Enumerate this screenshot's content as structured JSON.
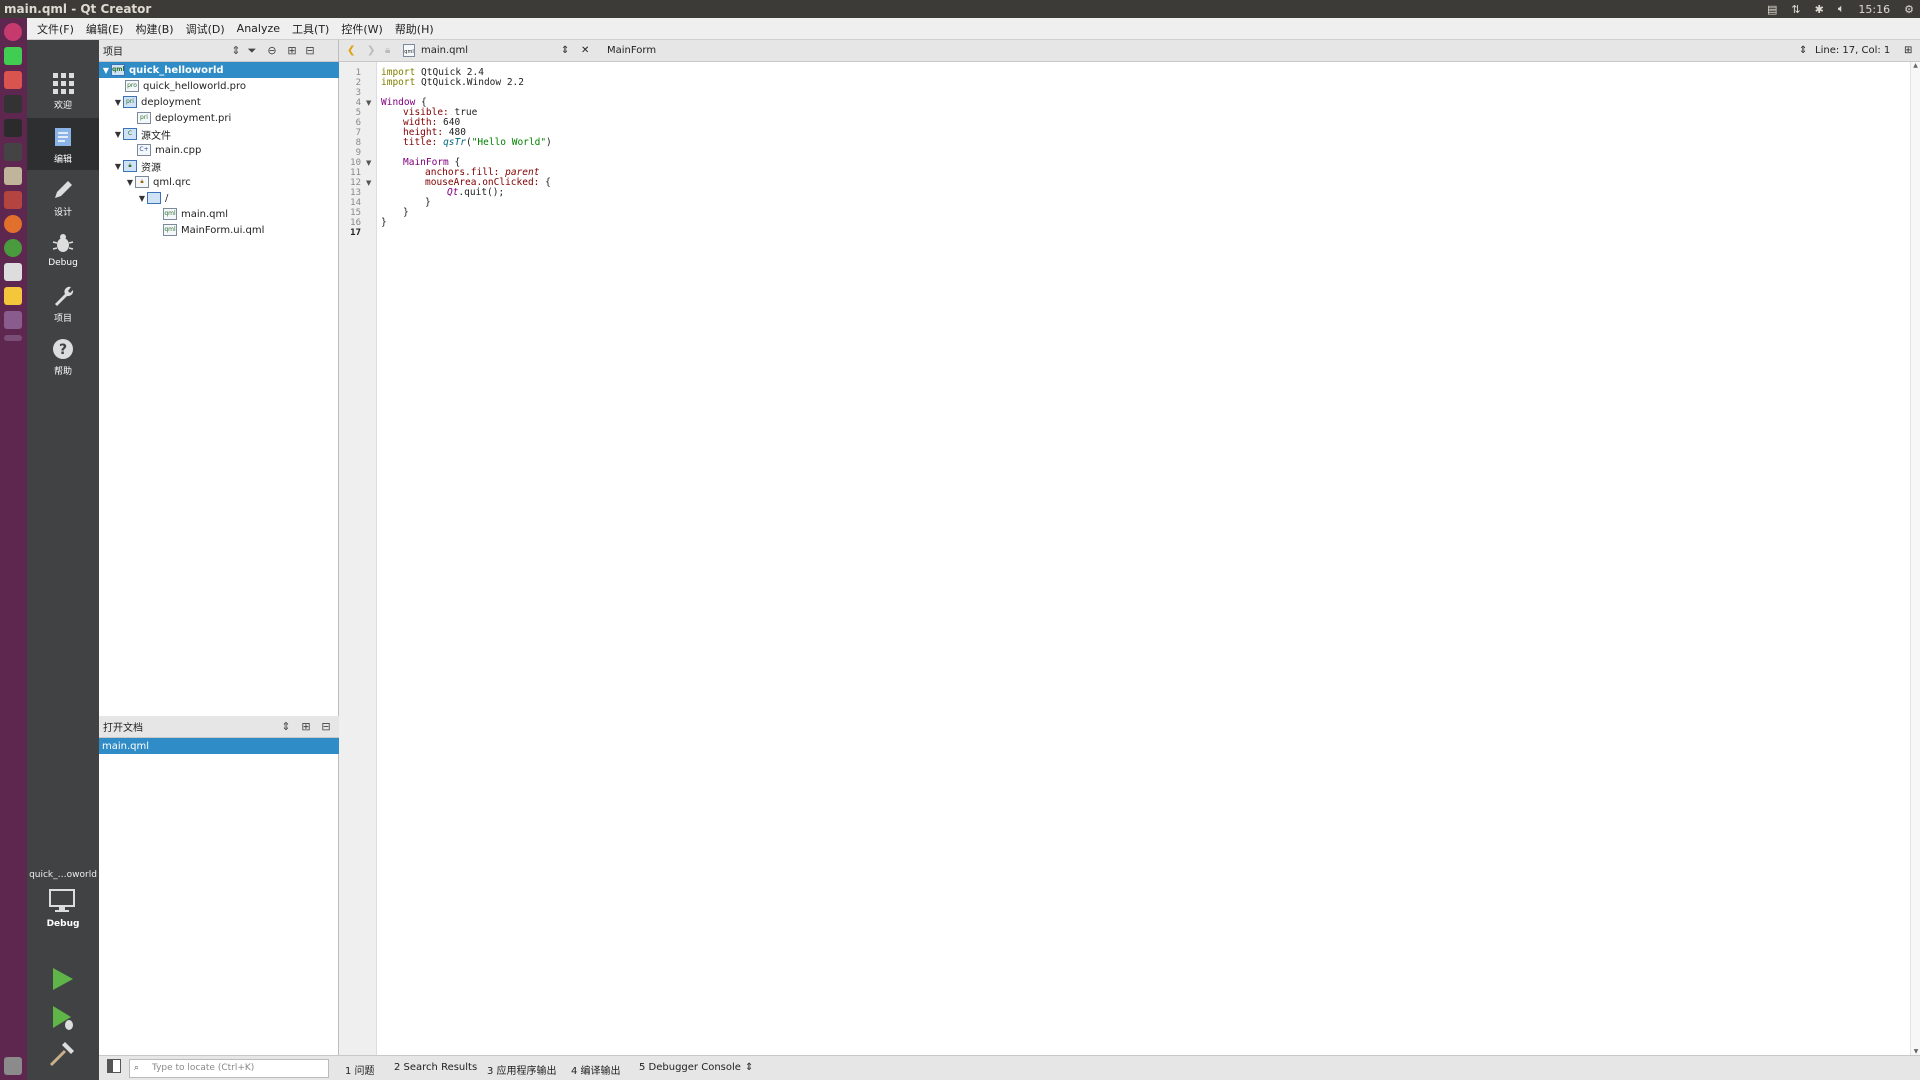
{
  "window": {
    "title": "main.qml - Qt Creator"
  },
  "tray": {
    "clock": "15:16"
  },
  "menubar": {
    "items": [
      "文件(F)",
      "编辑(E)",
      "构建(B)",
      "调试(D)",
      "Analyze",
      "工具(T)",
      "控件(W)",
      "帮助(H)"
    ]
  },
  "modes": {
    "welcome": "欢迎",
    "edit": "编辑",
    "design": "设计",
    "debug": "Debug",
    "projects": "项目",
    "help": "帮助"
  },
  "runkit": {
    "project": "quick_…oworld",
    "config": "Debug"
  },
  "projects_pane": {
    "title": "项目",
    "tree": [
      "quick_helloworld",
      "quick_helloworld.pro",
      "deployment",
      "deployment.pri",
      "源文件",
      "main.cpp",
      "资源",
      "qml.qrc",
      "/",
      "main.qml",
      "MainForm.ui.qml"
    ]
  },
  "open_docs": {
    "title": "打开文档",
    "items": [
      "main.qml"
    ]
  },
  "editor": {
    "file": "main.qml",
    "symbol": "MainForm",
    "cursor": "Line: 17, Col: 1",
    "line_numbers": [
      "1",
      "2",
      "3",
      "4",
      "5",
      "6",
      "7",
      "8",
      "9",
      "10",
      "11",
      "12",
      "13",
      "14",
      "15",
      "16",
      "17"
    ],
    "code": {
      "l1a": "import",
      "l1b": " QtQuick 2.4",
      "l2a": "import",
      "l2b": " QtQuick.Window 2.2",
      "l4a": "Window",
      "l4b": " {",
      "l5a": "visible:",
      "l5b": " true",
      "l6a": "width:",
      "l6b": " 640",
      "l7a": "height:",
      "l7b": " 480",
      "l8a": "title:",
      "l8b": "qsTr",
      "l8c": "(",
      "l8d": "\"Hello World\"",
      "l8e": ")",
      "l10a": "MainForm",
      "l10b": " {",
      "l11a": "anchors.fill:",
      "l11b": "parent",
      "l12a": "mouseArea.onClicked:",
      "l12b": " {",
      "l13a": "Qt",
      "l13b": ".quit();",
      "l14": "}",
      "l15": "}",
      "l16": "}"
    }
  },
  "statusbar": {
    "locate_placeholder": "Type to locate (Ctrl+K)",
    "tabs": [
      "1  问题",
      "2  Search Results",
      "3  应用程序输出",
      "4  编译输出",
      "5  Debugger Console"
    ]
  }
}
